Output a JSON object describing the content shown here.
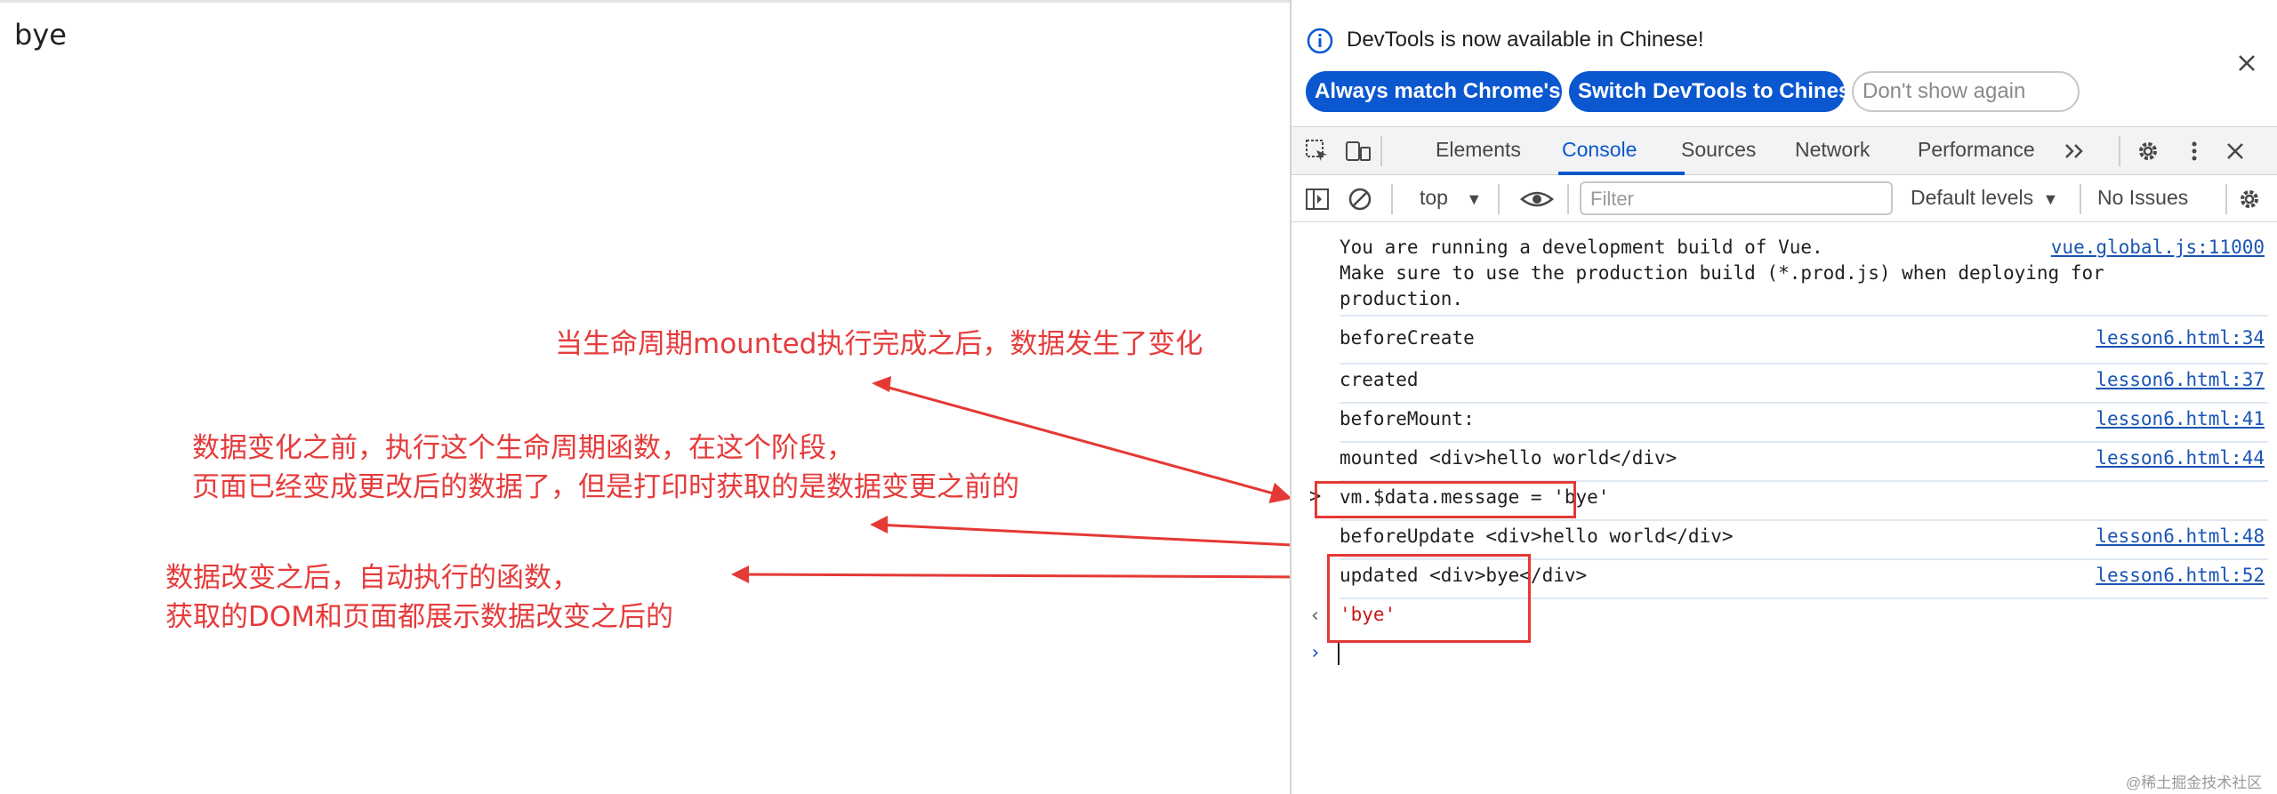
{
  "page": {
    "text": "bye",
    "annotations": [
      "当生命周期mounted执行完成之后，数据发生了变化",
      "数据变化之前，执行这个生命周期函数，在这个阶段，",
      "页面已经变成更改后的数据了，但是打印时获取的是数据变更之前的",
      "数据改变之后，自动执行的函数，",
      "获取的DOM和页面都展示数据改变之后的"
    ]
  },
  "devtools": {
    "banner": {
      "message": "DevTools is now available in Chinese!",
      "buttons": [
        "Always match Chrome's language",
        "Switch DevTools to Chinese",
        "Don't show again"
      ]
    },
    "tabs": [
      "Elements",
      "Console",
      "Sources",
      "Network",
      "Performance"
    ],
    "active_tab": "Console",
    "toolbar": {
      "context": "top",
      "filter_placeholder": "Filter",
      "levels": "Default levels",
      "issues": "No Issues"
    },
    "console": {
      "vue_warning": "You are running a development build of Vue.\nMake sure to use the production build (*.prod.js) when deploying for\nproduction.",
      "vue_warning_source": "vue.global.js:11000",
      "logs": [
        {
          "text": "beforeCreate",
          "source": "lesson6.html:34"
        },
        {
          "text": "created",
          "source": "lesson6.html:37"
        },
        {
          "text": "beforeMount:",
          "source": "lesson6.html:41"
        },
        {
          "text": "mounted <div>hello world</div>",
          "source": "lesson6.html:44"
        },
        {
          "text": "vm.$data.message = 'bye'",
          "source": ""
        },
        {
          "text": "beforeUpdate <div>hello world</div>",
          "source": "lesson6.html:48"
        },
        {
          "text": "updated <div>bye</div>",
          "source": "lesson6.html:52"
        }
      ],
      "result": "'bye'"
    },
    "accent_color": "#0b57d0",
    "link_color": "#1a55b5"
  },
  "watermark": "@稀土掘金技术社区"
}
